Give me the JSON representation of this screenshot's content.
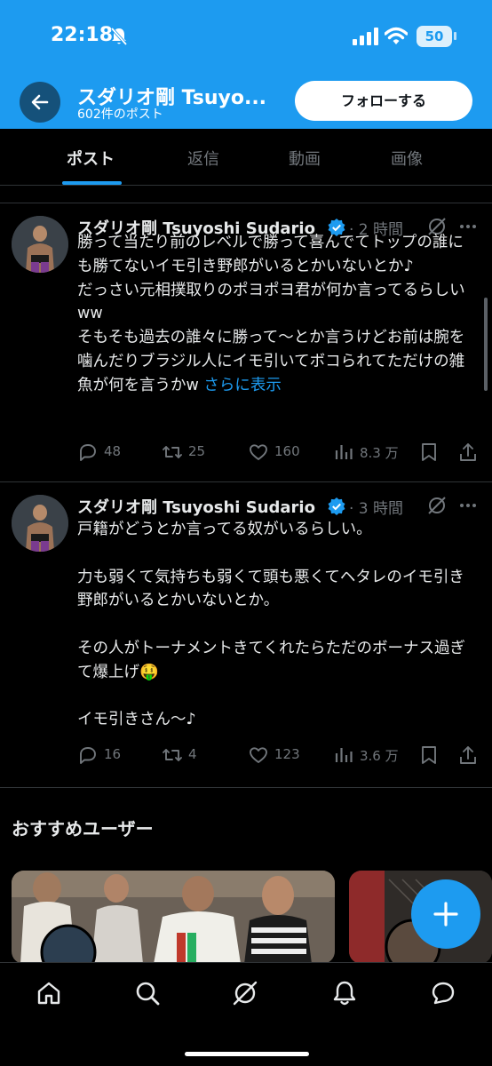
{
  "status_bar": {
    "time": "22:18",
    "battery": "50"
  },
  "header": {
    "profile_name": "スダリオ剛 Tsuyo...",
    "post_count": "602件のポスト",
    "follow_label": "フォローする"
  },
  "tabs": [
    {
      "label": "ポスト",
      "active": true
    },
    {
      "label": "返信",
      "active": false
    },
    {
      "label": "動画",
      "active": false
    },
    {
      "label": "画像",
      "active": false
    }
  ],
  "tweets": [
    {
      "name": "スダリオ剛 Tsuyoshi Sudario",
      "time": "· 2 時間",
      "body": "勝って当たり前のレベルで勝って喜んでてトップの誰にも勝てないイモ引き野郎がいるとかいないとか♪\nだっさい元相撲取りのポヨポヨ君が何か言ってるらしいww\nそもそも過去の誰々に勝って〜とか言うけどお前は腕を噛んだりブラジル人にイモ引いてボコられてただけの雑魚が何を言うかw ",
      "show_more": "さらに表示",
      "replies": "48",
      "reposts": "25",
      "likes": "160",
      "views": "8.3 万"
    },
    {
      "name": "スダリオ剛 Tsuyoshi Sudario",
      "time": "· 3 時間",
      "body": "戸籍がどうとか言ってる奴がいるらしい。\n\n力も弱くて気持ちも弱くて頭も悪くてヘタレのイモ引き野郎がいるとかいないとか。\n\nその人がトーナメントきてくれたらただのボーナス過ぎて爆上げ🤑\n\nイモ引きさん〜♪",
      "show_more": "",
      "replies": "16",
      "reposts": "4",
      "likes": "123",
      "views": "3.6 万"
    }
  ],
  "recommended": {
    "title": "おすすめユーザー"
  },
  "icons": {
    "back": "arrow-left-icon",
    "verified": "verified-badge-icon",
    "grok": "grok-icon",
    "more": "more-icon",
    "reply": "reply-icon",
    "repost": "repost-icon",
    "like": "like-icon",
    "views": "views-icon",
    "bookmark": "bookmark-icon",
    "share": "share-icon",
    "compose": "plus-icon",
    "nav": [
      "home-icon",
      "search-icon",
      "grok-icon",
      "notifications-icon",
      "messages-icon"
    ]
  },
  "colors": {
    "accent": "#1d9bf0",
    "background": "#000000",
    "text": "#e7e9ea",
    "muted": "#71767b"
  }
}
